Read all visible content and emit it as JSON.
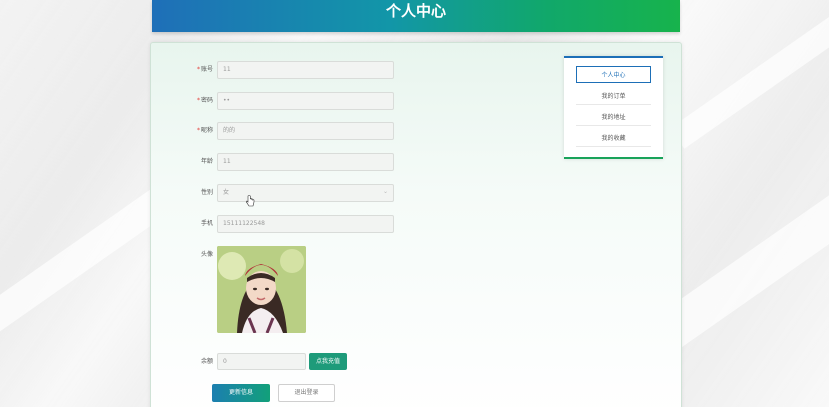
{
  "header": {
    "title": "个人中心"
  },
  "form": {
    "fields": [
      {
        "label": "账号",
        "required": true,
        "value": "11",
        "type": "text"
      },
      {
        "label": "密码",
        "required": true,
        "value": "••",
        "type": "password"
      },
      {
        "label": "昵称",
        "required": true,
        "value": "的的",
        "type": "text"
      },
      {
        "label": "年龄",
        "required": false,
        "value": "11",
        "type": "text"
      },
      {
        "label": "性别",
        "required": false,
        "value": "女",
        "type": "select"
      },
      {
        "label": "手机",
        "required": false,
        "value": "15111122548",
        "type": "text"
      }
    ],
    "avatar_label": "头像",
    "balance": {
      "label": "余额",
      "value": "0"
    },
    "recharge_label": "点我充值",
    "update_label": "更新信息",
    "logout_label": "退出登录"
  },
  "sidebar": {
    "items": [
      {
        "label": "个人中心",
        "active": true
      },
      {
        "label": "我的订单",
        "active": false
      },
      {
        "label": "我的地址",
        "active": false
      },
      {
        "label": "我的收藏",
        "active": false
      }
    ]
  },
  "colors": {
    "header_gradient_start": "#1f6fb8",
    "header_gradient_end": "#17b34c",
    "accent_blue": "#1d6fb7",
    "accent_green": "#1e9b7a",
    "required_star": "#e53935"
  }
}
